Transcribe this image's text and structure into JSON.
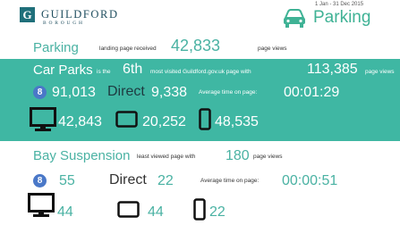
{
  "header": {
    "logo_letter": "G",
    "logo_name": "GUILDFORD",
    "logo_sub": "BOROUGH",
    "date_range": "1 Jan - 31 Dec 2015",
    "page_title": "Parking",
    "title_icon": "car-icon"
  },
  "landing": {
    "name": "Parking",
    "label": "landing page received",
    "views": "42,833",
    "views_label": "page views"
  },
  "car_parks": {
    "name": "Car Parks",
    "is_the": "is the",
    "rank": "6th",
    "rank_label": "most visited Guildford.gov.uk page with",
    "views": "113,385",
    "views_label": "page views",
    "search_icon": "google-icon",
    "search_letter": "8",
    "search": "91,013",
    "direct_label": "Direct",
    "direct": "9,338",
    "avg_label": "Average time on page:",
    "avg_time": "00:01:29",
    "desktop": "42,843",
    "tablet": "20,252",
    "mobile": "48,535"
  },
  "bay_suspension": {
    "name": "Bay Suspension",
    "label": "least viewed page with",
    "views": "180",
    "views_label": "page views",
    "search_letter": "8",
    "search": "55",
    "direct_label": "Direct",
    "direct": "22",
    "avg_label": "Average time on page:",
    "avg_time": "00:00:51",
    "desktop": "44",
    "tablet": "44",
    "mobile": "22"
  },
  "colors": {
    "teal": "#3fb7a3",
    "teal_text": "#4ab2a3",
    "logo": "#1f6f7a",
    "google_badge": "#4a78c8"
  }
}
